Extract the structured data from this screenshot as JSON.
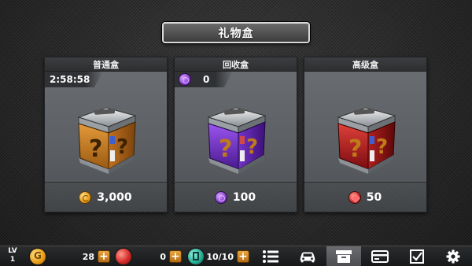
{
  "title": "礼物盒",
  "cards": [
    {
      "name": "普通盒",
      "badge": "2:58:58",
      "price": "3,000",
      "currency_icon": "gold-coin-icon",
      "box_color": "#d4852a"
    },
    {
      "name": "回收盒",
      "badge": "0",
      "price": "100",
      "currency_icon": "recycle-coin-icon",
      "box_color": "#7a3ad0"
    },
    {
      "name": "高级盒",
      "badge": "",
      "price": "50",
      "currency_icon": "ruby-gem-icon",
      "box_color": "#c32428"
    }
  ],
  "bottom": {
    "level_label": "LV",
    "level_value": "1",
    "gold": "28",
    "gems": "0",
    "fuel": "10/10",
    "nav_icons": [
      "list-icon",
      "car-icon",
      "box-icon",
      "card-icon",
      "checklist-icon",
      "settings-gear-icon"
    ]
  }
}
